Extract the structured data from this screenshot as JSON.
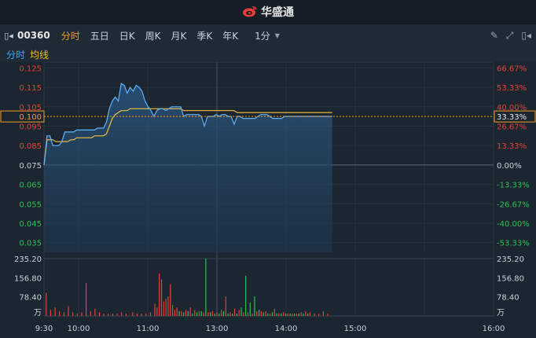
{
  "app": {
    "brand": "华盛通"
  },
  "toolbar": {
    "code": "00360",
    "tabs": [
      "分时",
      "五日",
      "日K",
      "周K",
      "月K",
      "季K",
      "年K"
    ],
    "active_tab": 0,
    "interval": "1分"
  },
  "subtabs": {
    "first": "分时",
    "second": "均线"
  },
  "current": {
    "price_label": "0.100",
    "pct_label": "33.33%"
  },
  "colors": {
    "up": "#e8403a",
    "down": "#2ec05a",
    "price_line": "#5fb4ff",
    "avg_line": "#f0c040",
    "accent": "#f0a020"
  },
  "chart_data": {
    "type": "line",
    "price_ticks": [
      "0.125",
      "0.115",
      "0.105",
      "0.095",
      "0.085",
      "0.075",
      "0.065",
      "0.055",
      "0.045",
      "0.035"
    ],
    "pct_ticks": [
      "66.67%",
      "53.33%",
      "40.00%",
      "26.67%",
      "13.33%",
      "0.00%",
      "-13.33%",
      "-26.67%",
      "-40.00%",
      "-53.33%"
    ],
    "ylim": [
      0.03,
      0.128
    ],
    "base_price": 0.075,
    "x_ticks": [
      "9:30",
      "10:00",
      "11:00",
      "13:00",
      "14:00",
      "15:00",
      "16:00"
    ],
    "volume_ticks": [
      "235.20",
      "156.80",
      "78.40"
    ],
    "volume_unit": "万",
    "volume_max": 235.2,
    "price_series": [
      0.075,
      0.09,
      0.09,
      0.085,
      0.085,
      0.085,
      0.087,
      0.092,
      0.092,
      0.092,
      0.092,
      0.093,
      0.093,
      0.093,
      0.093,
      0.093,
      0.093,
      0.093,
      0.094,
      0.094,
      0.094,
      0.097,
      0.104,
      0.108,
      0.11,
      0.108,
      0.117,
      0.116,
      0.112,
      0.115,
      0.113,
      0.116,
      0.115,
      0.113,
      0.108,
      0.105,
      0.103,
      0.1,
      0.103,
      0.104,
      0.104,
      0.103,
      0.104,
      0.105,
      0.105,
      0.105,
      0.105,
      0.1,
      0.101,
      0.101,
      0.101,
      0.101,
      0.101,
      0.1,
      0.095,
      0.1,
      0.1,
      0.1,
      0.101,
      0.1,
      0.101,
      0.101,
      0.1,
      0.1,
      0.096,
      0.1,
      0.1,
      0.099,
      0.099,
      0.099,
      0.099,
      0.099,
      0.1,
      0.101,
      0.101,
      0.101,
      0.1,
      0.099,
      0.099,
      0.099,
      0.099,
      0.1,
      0.1,
      0.1,
      0.1,
      0.1,
      0.1,
      0.1,
      0.1,
      0.1,
      0.1,
      0.1,
      0.1,
      0.1,
      0.1,
      0.1,
      0.1,
      0.1
    ],
    "avg_series": [
      0.075,
      0.088,
      0.088,
      0.088,
      0.087,
      0.087,
      0.087,
      0.087,
      0.087,
      0.088,
      0.088,
      0.089,
      0.089,
      0.089,
      0.089,
      0.089,
      0.089,
      0.09,
      0.09,
      0.09,
      0.09,
      0.091,
      0.095,
      0.099,
      0.101,
      0.102,
      0.103,
      0.103,
      0.103,
      0.104,
      0.104,
      0.104,
      0.104,
      0.104,
      0.104,
      0.104,
      0.104,
      0.104,
      0.104,
      0.104,
      0.104,
      0.104,
      0.104,
      0.104,
      0.104,
      0.104,
      0.104,
      0.103,
      0.103,
      0.103,
      0.103,
      0.103,
      0.103,
      0.103,
      0.103,
      0.103,
      0.103,
      0.103,
      0.103,
      0.103,
      0.103,
      0.103,
      0.103,
      0.103,
      0.103,
      0.102,
      0.102,
      0.102,
      0.102,
      0.102,
      0.102,
      0.102,
      0.102,
      0.102,
      0.102,
      0.102,
      0.102,
      0.102,
      0.102,
      0.102,
      0.102,
      0.102,
      0.102,
      0.102,
      0.102,
      0.102,
      0.102,
      0.102,
      0.102,
      0.102,
      0.102,
      0.102,
      0.102,
      0.102,
      0.102,
      0.102,
      0.102,
      0.102
    ],
    "volume_bars": [
      {
        "i": 1,
        "v": 95,
        "up": true
      },
      {
        "i": 3,
        "v": 25,
        "up": true
      },
      {
        "i": 5,
        "v": 35,
        "up": true
      },
      {
        "i": 7,
        "v": 20,
        "up": true
      },
      {
        "i": 9,
        "v": 15,
        "up": true
      },
      {
        "i": 11,
        "v": 40,
        "up": true
      },
      {
        "i": 13,
        "v": 15,
        "up": true
      },
      {
        "i": 15,
        "v": 10,
        "up": true
      },
      {
        "i": 17,
        "v": 15,
        "up": true
      },
      {
        "i": 19,
        "v": 135,
        "up": true
      },
      {
        "i": 21,
        "v": 20,
        "up": true
      },
      {
        "i": 23,
        "v": 30,
        "up": true
      },
      {
        "i": 25,
        "v": 15,
        "up": true
      },
      {
        "i": 27,
        "v": 10,
        "up": true
      },
      {
        "i": 29,
        "v": 10,
        "up": true
      },
      {
        "i": 31,
        "v": 10,
        "up": true
      },
      {
        "i": 33,
        "v": 10,
        "up": true
      },
      {
        "i": 35,
        "v": 15,
        "up": true
      },
      {
        "i": 37,
        "v": 10,
        "up": true
      },
      {
        "i": 40,
        "v": 15,
        "up": true
      },
      {
        "i": 42,
        "v": 10,
        "up": true
      },
      {
        "i": 44,
        "v": 10,
        "up": true
      },
      {
        "i": 46,
        "v": 10,
        "up": true
      },
      {
        "i": 48,
        "v": 15,
        "up": true
      },
      {
        "i": 50,
        "v": 50,
        "up": true
      },
      {
        "i": 51,
        "v": 35,
        "up": true
      },
      {
        "i": 52,
        "v": 175,
        "up": true
      },
      {
        "i": 53,
        "v": 150,
        "up": true
      },
      {
        "i": 54,
        "v": 60,
        "up": true
      },
      {
        "i": 55,
        "v": 70,
        "up": true
      },
      {
        "i": 56,
        "v": 80,
        "up": true
      },
      {
        "i": 57,
        "v": 130,
        "up": true
      },
      {
        "i": 58,
        "v": 45,
        "up": true
      },
      {
        "i": 59,
        "v": 25,
        "up": true
      },
      {
        "i": 60,
        "v": 35,
        "up": true
      },
      {
        "i": 62,
        "v": 20,
        "up": true
      },
      {
        "i": 64,
        "v": 25,
        "up": true
      },
      {
        "i": 66,
        "v": 35,
        "up": true
      },
      {
        "i": 68,
        "v": 25,
        "up": true
      },
      {
        "i": 70,
        "v": 20,
        "up": true
      },
      {
        "i": 72,
        "v": 15,
        "up": true
      },
      {
        "i": 74,
        "v": 15,
        "up": true
      },
      {
        "i": 76,
        "v": 20,
        "up": true
      },
      {
        "i": 78,
        "v": 15,
        "up": true
      },
      {
        "i": 80,
        "v": 25,
        "up": true
      },
      {
        "i": 82,
        "v": 80,
        "up": true
      },
      {
        "i": 84,
        "v": 15,
        "up": true
      },
      {
        "i": 86,
        "v": 30,
        "up": true
      },
      {
        "i": 88,
        "v": 25,
        "up": true
      },
      {
        "i": 90,
        "v": 15,
        "up": true
      },
      {
        "i": 92,
        "v": 15,
        "up": true
      },
      {
        "i": 94,
        "v": 10,
        "up": true
      },
      {
        "i": 96,
        "v": 20,
        "up": true
      },
      {
        "i": 98,
        "v": 20,
        "up": true
      },
      {
        "i": 100,
        "v": 20,
        "up": true
      },
      {
        "i": 102,
        "v": 10,
        "up": true
      },
      {
        "i": 104,
        "v": 30,
        "up": true
      },
      {
        "i": 106,
        "v": 10,
        "up": true
      },
      {
        "i": 108,
        "v": 15,
        "up": true
      },
      {
        "i": 110,
        "v": 10,
        "up": true
      },
      {
        "i": 112,
        "v": 10,
        "up": true
      },
      {
        "i": 114,
        "v": 10,
        "up": true
      },
      {
        "i": 116,
        "v": 15,
        "up": true
      },
      {
        "i": 118,
        "v": 20,
        "up": true
      },
      {
        "i": 120,
        "v": 15,
        "up": true
      },
      {
        "i": 122,
        "v": 10,
        "up": true
      },
      {
        "i": 124,
        "v": 10,
        "up": true
      },
      {
        "i": 126,
        "v": 20,
        "up": true
      },
      {
        "i": 128,
        "v": 10,
        "up": true
      },
      {
        "i": 61,
        "v": 20,
        "up": false
      },
      {
        "i": 63,
        "v": 15,
        "up": false
      },
      {
        "i": 65,
        "v": 20,
        "up": false
      },
      {
        "i": 67,
        "v": 10,
        "up": false
      },
      {
        "i": 69,
        "v": 15,
        "up": false
      },
      {
        "i": 71,
        "v": 20,
        "up": false
      },
      {
        "i": 73,
        "v": 235,
        "up": false
      },
      {
        "i": 75,
        "v": 15,
        "up": false
      },
      {
        "i": 77,
        "v": 10,
        "up": false
      },
      {
        "i": 79,
        "v": 10,
        "up": false
      },
      {
        "i": 81,
        "v": 20,
        "up": false
      },
      {
        "i": 83,
        "v": 10,
        "up": false
      },
      {
        "i": 85,
        "v": 10,
        "up": false
      },
      {
        "i": 87,
        "v": 10,
        "up": false
      },
      {
        "i": 89,
        "v": 35,
        "up": false
      },
      {
        "i": 91,
        "v": 165,
        "up": false
      },
      {
        "i": 93,
        "v": 55,
        "up": false
      },
      {
        "i": 95,
        "v": 80,
        "up": false
      },
      {
        "i": 97,
        "v": 25,
        "up": false
      },
      {
        "i": 99,
        "v": 15,
        "up": false
      },
      {
        "i": 101,
        "v": 10,
        "up": false
      },
      {
        "i": 103,
        "v": 15,
        "up": false
      },
      {
        "i": 105,
        "v": 10,
        "up": false
      },
      {
        "i": 107,
        "v": 10,
        "up": false
      },
      {
        "i": 109,
        "v": 10,
        "up": false
      },
      {
        "i": 111,
        "v": 10,
        "up": false
      },
      {
        "i": 113,
        "v": 10,
        "up": false
      },
      {
        "i": 115,
        "v": 10,
        "up": false
      },
      {
        "i": 117,
        "v": 10,
        "up": false
      },
      {
        "i": 119,
        "v": 10,
        "up": false
      }
    ]
  }
}
